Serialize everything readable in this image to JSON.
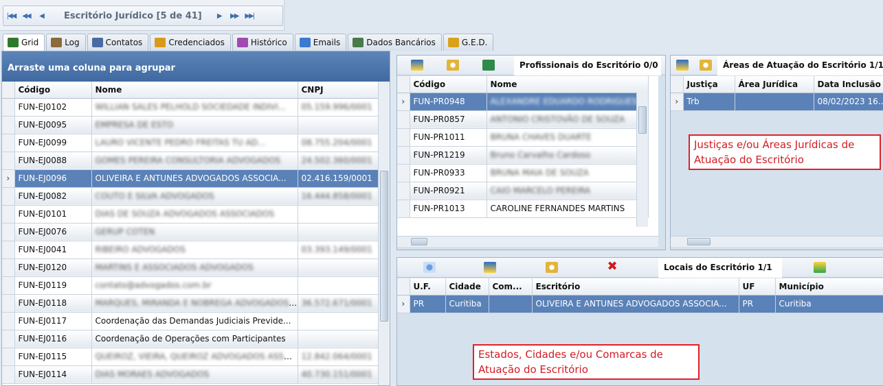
{
  "navigator": {
    "title": "Escritório Jurídico [5 de 41]"
  },
  "tabs": [
    {
      "label": "Grid",
      "icon": "grid-icon",
      "color": "#2c7a2c"
    },
    {
      "label": "Log",
      "icon": "users-icon",
      "color": "#8a6a3a"
    },
    {
      "label": "Contatos",
      "icon": "contact-card-icon",
      "color": "#4a6aa3"
    },
    {
      "label": "Credenciados",
      "icon": "credential-icon",
      "color": "#d99a1a"
    },
    {
      "label": "Histórico",
      "icon": "history-icon",
      "color": "#a34ab0"
    },
    {
      "label": "Emails",
      "icon": "email-icon",
      "color": "#3a7ad0"
    },
    {
      "label": "Dados Bancários",
      "icon": "bank-card-icon",
      "color": "#4a7a4a"
    },
    {
      "label": "G.E.D.",
      "icon": "document-icon",
      "color": "#d9a21a"
    }
  ],
  "left_grid": {
    "group_hint": "Arraste uma coluna para agrupar",
    "columns": [
      "Código",
      "Nome",
      "CNPJ"
    ],
    "rows": [
      {
        "codigo": "FUN-EJ0102",
        "nome": "WILLIAN SALES PELHOLD SOCIEDADE INDIVI...",
        "cnpj": "05.159.996/0001",
        "blur": true
      },
      {
        "codigo": "FUN-EJ0095",
        "nome": "EMPRESA DE ESTO",
        "cnpj": "",
        "blur": true
      },
      {
        "codigo": "FUN-EJ0099",
        "nome": "LAURO VICENTE PEDRO FREITAS TU AD...",
        "cnpj": "08.755.204/0001",
        "blur": true
      },
      {
        "codigo": "FUN-EJ0088",
        "nome": "GOMES PEREIRA CONSULTORIA ADVOGADOS",
        "cnpj": "24.502.360/0001",
        "blur": true
      },
      {
        "codigo": "FUN-EJ0096",
        "nome": "OLIVEIRA E ANTUNES ADVOGADOS ASSOCIA...",
        "cnpj": "02.416.159/0001",
        "selected": true
      },
      {
        "codigo": "FUN-EJ0082",
        "nome": "COUTO E SILVA ADVOGADOS",
        "cnpj": "16.444.858/0001",
        "blur": true
      },
      {
        "codigo": "FUN-EJ0101",
        "nome": "DIAS DE SOUZA ADVOGADOS ASSOCIADOS",
        "cnpj": "",
        "blur": true
      },
      {
        "codigo": "FUN-EJ0076",
        "nome": "GERUP COTEN",
        "cnpj": "",
        "blur": true
      },
      {
        "codigo": "FUN-EJ0041",
        "nome": "RIBEIRO ADVOGADOS",
        "cnpj": "03.393.149/0001",
        "blur": true
      },
      {
        "codigo": "FUN-EJ0120",
        "nome": "MARTINS E ASSOCIADOS ADVOGADOS",
        "cnpj": "",
        "blur": true
      },
      {
        "codigo": "FUN-EJ0119",
        "nome": "contato@advogados.com.br",
        "cnpj": "",
        "blur": true
      },
      {
        "codigo": "FUN-EJ0118",
        "nome": "MARQUES, MIRANDA E NOBREGA ADVOGADOS ...",
        "cnpj": "36.572.671/0001",
        "blur": true
      },
      {
        "codigo": "FUN-EJ0117",
        "nome": "Coordenação das Demandas Judiciais Previde...",
        "cnpj": ""
      },
      {
        "codigo": "FUN-EJ0116",
        "nome": "Coordenação de Operações com Participantes",
        "cnpj": ""
      },
      {
        "codigo": "FUN-EJ0115",
        "nome": "QUEIROZ, VIEIRA, QUEIROZ ADVOGADOS ASSOC...",
        "cnpj": "12.842.064/0001",
        "blur": true
      },
      {
        "codigo": "FUN-EJ0114",
        "nome": "DIAS MORAES ADVOGADOS",
        "cnpj": "40.730.151/0001",
        "blur": true
      }
    ]
  },
  "professionals": {
    "title": "Profissionais do Escritório 0/0",
    "columns": [
      "Código",
      "Nome"
    ],
    "rows": [
      {
        "codigo": "FUN-PR0948",
        "nome": "ALEXANDRE EDUARDO RODRIGUES A",
        "selected": true,
        "blur": true
      },
      {
        "codigo": "FUN-PR0857",
        "nome": "ANTONIO CRISTOVÃO DE SOUZA",
        "blur": true
      },
      {
        "codigo": "FUN-PR1011",
        "nome": "BRUNA CHAVES DUARTE",
        "blur": true
      },
      {
        "codigo": "FUN-PR1219",
        "nome": "Bruno Carvalho Cardoso",
        "blur": true
      },
      {
        "codigo": "FUN-PR0933",
        "nome": "BRUNA MAIA DE SOUZA",
        "blur": true
      },
      {
        "codigo": "FUN-PR0921",
        "nome": "CAIO MARCELO PEREIRA",
        "blur": true
      },
      {
        "codigo": "FUN-PR1013",
        "nome": "CAROLINE FERNANDES MARTINS",
        "blur": false
      }
    ]
  },
  "areas": {
    "title": "Áreas de Atuação do Escritório 1/1",
    "columns": [
      "Justiça",
      "Área Jurídica",
      "Data Inclusão"
    ],
    "rows": [
      {
        "justica": "Trb",
        "area": "",
        "data": "08/02/2023 16..."
      }
    ],
    "annotation": "Justiças e/ou Áreas Jurídicas de Atuação do Escritório"
  },
  "locais": {
    "title": "Locais do Escritório 1/1",
    "columns": [
      "U.F.",
      "Cidade",
      "Com...",
      "Escritório",
      "UF",
      "Município"
    ],
    "rows": [
      {
        "uf": "PR",
        "cidade": "Curitiba",
        "com": "",
        "escritorio": "OLIVEIRA E ANTUNES ADVOGADOS ASSOCIA...",
        "uf2": "PR",
        "municipio": "Curitiba"
      }
    ],
    "annotation": "Estados, Cidades e/ou Comarcas de Atuação do Escritório"
  }
}
